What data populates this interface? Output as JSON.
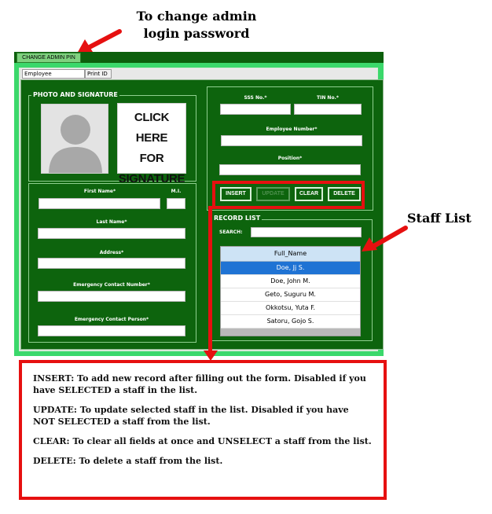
{
  "annotations": {
    "admin_note_line1": "To change admin",
    "admin_note_line2": "login password",
    "staff_note": "Staff List",
    "descriptions": [
      "INSERT: To add new record after filling out the form. Disabled if you have SELECTED a staff in the list.",
      "UPDATE: To update selected staff in the list. Disabled if you have NOT SELECTED a staff from the list.",
      "CLEAR: To clear all fields at once and UNSELECT a staff from the list.",
      "DELETE: To delete a staff from the list."
    ]
  },
  "toolbar": {
    "change_pin_label": "CHANGE ADMIN PIN"
  },
  "tabs": [
    {
      "label": "Employee Information",
      "active": true
    },
    {
      "label": "Print ID",
      "active": false
    }
  ],
  "photo_group": {
    "legend": "PHOTO AND SIGNATURE",
    "signature_text": "CLICK HERE\nFOR\nSIGNATURE"
  },
  "form": {
    "first_name_label": "First Name*",
    "mi_label": "M.I.",
    "last_name_label": "Last Name*",
    "address_label": "Address*",
    "emergency_number_label": "Emergency Contact Number*",
    "emergency_person_label": "Emergency Contact Person*",
    "sss_label": "SSS No.*",
    "tin_label": "TIN No.*",
    "employee_number_label": "Employee Number*",
    "position_label": "Position*"
  },
  "buttons": {
    "insert": "INSERT",
    "update": "UPDATE",
    "clear": "CLEAR",
    "delete": "DELETE"
  },
  "record_list": {
    "legend": "RECORD LIST",
    "search_label": "SEARCH:",
    "column_header": "Full_Name",
    "rows": [
      "Doe, Jj S.",
      "Doe, John M.",
      "Geto, Suguru M.",
      "Okkotsu, Yuta F.",
      "Satoru, Gojo S."
    ],
    "selected_index": 0
  },
  "colors": {
    "panel_green": "#0d640d",
    "window_green": "#3bd86b",
    "annotation_red": "#e61010",
    "selection_blue": "#1f73d4"
  }
}
